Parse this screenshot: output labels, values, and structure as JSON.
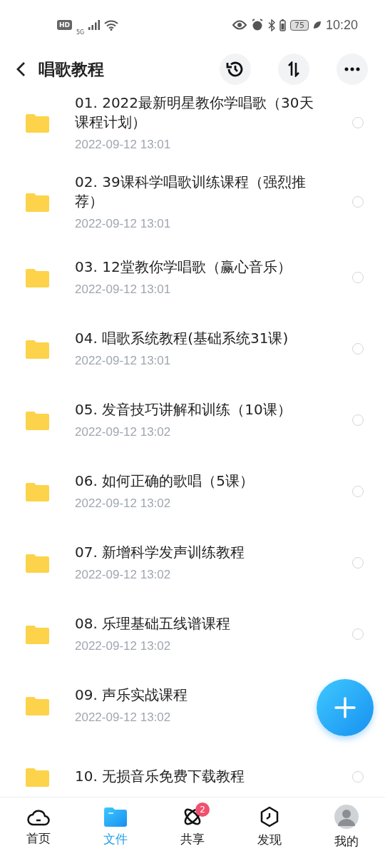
{
  "status_bar": {
    "left_badge": "HD",
    "network": "5G",
    "battery": "75",
    "time": "10:20"
  },
  "header": {
    "title": "唱歌教程"
  },
  "files": [
    {
      "name": "01. 2022最新明星教你学唱歌（30天课程计划）",
      "date": "2022-09-12  13:01",
      "selected": false
    },
    {
      "name": "02. 39课科学唱歌训练课程（强烈推荐）",
      "date": "2022-09-12  13:01",
      "selected": false
    },
    {
      "name": "03. 12堂教你学唱歌（赢心音乐）",
      "date": "2022-09-12  13:01",
      "selected": false
    },
    {
      "name": "04. 唱歌系统教程(基础系统31课)",
      "date": "2022-09-12  13:01",
      "selected": false
    },
    {
      "name": "05. 发音技巧讲解和训练（10课）",
      "date": "2022-09-12  13:02",
      "selected": false
    },
    {
      "name": "06. 如何正确的歌唱（5课）",
      "date": "2022-09-12  13:02",
      "selected": false
    },
    {
      "name": "07. 新增科学发声训练教程",
      "date": "2022-09-12  13:02",
      "selected": false
    },
    {
      "name": "08. 乐理基础五线谱课程",
      "date": "2022-09-12  13:02",
      "selected": false
    },
    {
      "name": "09. 声乐实战课程",
      "date": "2022-09-12  13:02"
    },
    {
      "name": "10. 无损音乐免费下载教程",
      "selected": false
    }
  ],
  "bottom_nav": [
    {
      "kind": "home",
      "label": "首页",
      "selected": false
    },
    {
      "kind": "files",
      "label": "文件",
      "selected": true
    },
    {
      "kind": "share",
      "label": "共享",
      "selected": false,
      "badge": "2"
    },
    {
      "kind": "discover",
      "label": "发现",
      "selected": false
    },
    {
      "kind": "me",
      "label": "我的",
      "selected": false
    }
  ]
}
